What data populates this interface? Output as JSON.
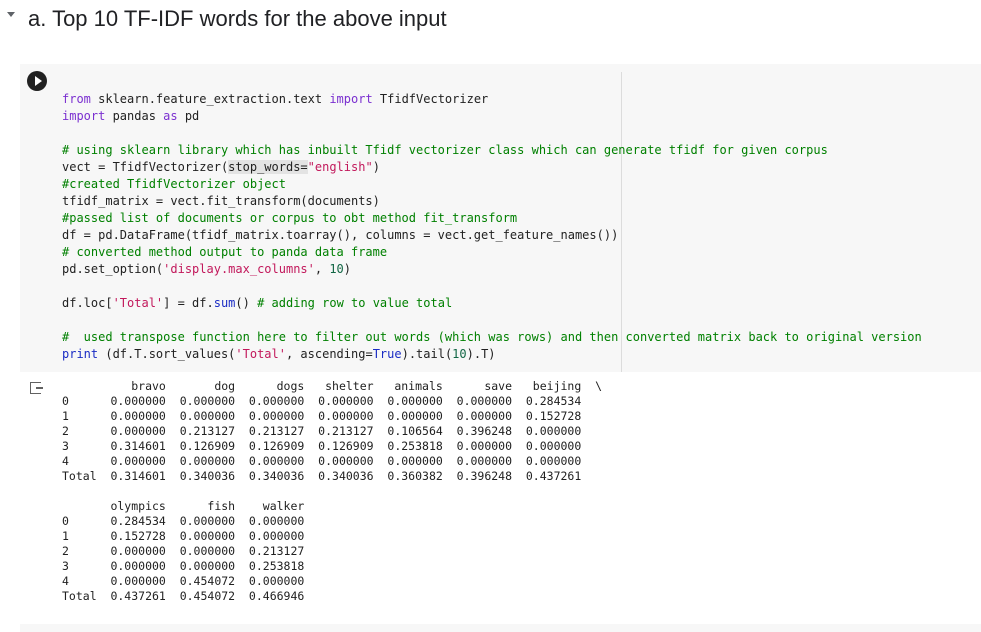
{
  "section": {
    "title": "a. Top 10 TF-IDF words for the above input"
  },
  "code_cell": {
    "run_button_icon": "play-icon",
    "lines": [
      [
        {
          "t": "from",
          "c": "kw"
        },
        {
          "t": " sklearn.feature_extraction.text "
        },
        {
          "t": "import",
          "c": "kw"
        },
        {
          "t": " TfidfVectorizer"
        }
      ],
      [
        {
          "t": "import",
          "c": "kw"
        },
        {
          "t": " pandas "
        },
        {
          "t": "as",
          "c": "kw"
        },
        {
          "t": " pd"
        }
      ],
      [],
      [
        {
          "t": "# using sklearn library which has inbuilt Tfidf vectorizer class which can generate tfidf for given corpus",
          "c": "cm"
        }
      ],
      [
        {
          "t": "vect = TfidfVectorizer("
        },
        {
          "t": "stop_words=",
          "c": "sel"
        },
        {
          "t": "\"english\"",
          "c": "st"
        },
        {
          "t": ")"
        }
      ],
      [
        {
          "t": "#created TfidfVectorizer object",
          "c": "cm"
        }
      ],
      [
        {
          "t": "tfidf_matrix = vect.fit_transform(documents)"
        }
      ],
      [
        {
          "t": "#passed list of documents or corpus to obt method fit_transform",
          "c": "cm"
        }
      ],
      [
        {
          "t": "df = pd.DataFrame(tfidf_matrix.toarray(), columns = vect.get_feature_names())"
        }
      ],
      [
        {
          "t": "# converted method output to panda data frame",
          "c": "cm"
        }
      ],
      [
        {
          "t": "pd.set_option("
        },
        {
          "t": "'display.max_columns'",
          "c": "st"
        },
        {
          "t": ", "
        },
        {
          "t": "10",
          "c": "nm"
        },
        {
          "t": ")"
        }
      ],
      [],
      [
        {
          "t": "df.loc["
        },
        {
          "t": "'Total'",
          "c": "st"
        },
        {
          "t": "] = df."
        },
        {
          "t": "sum",
          "c": "bl"
        },
        {
          "t": "() "
        },
        {
          "t": "# adding row to value total",
          "c": "cm"
        }
      ],
      [],
      [
        {
          "t": "#  used transpose function here to filter out words (which was rows) and then converted matrix back to original version",
          "c": "cm"
        }
      ],
      [
        {
          "t": "print",
          "c": "bl"
        },
        {
          "t": " (df.T.sort_values("
        },
        {
          "t": "'Total'",
          "c": "st"
        },
        {
          "t": ", ascending="
        },
        {
          "t": "True",
          "c": "bl"
        },
        {
          "t": ").tail("
        },
        {
          "t": "10",
          "c": "nm"
        },
        {
          "t": ").T)"
        }
      ]
    ]
  },
  "output": {
    "icon": "output-redirect-icon",
    "lines": [
      "          bravo       dog      dogs   shelter   animals      save   beijing  \\",
      "0      0.000000  0.000000  0.000000  0.000000  0.000000  0.000000  0.284534",
      "1      0.000000  0.000000  0.000000  0.000000  0.000000  0.000000  0.152728",
      "2      0.000000  0.213127  0.213127  0.213127  0.106564  0.396248  0.000000",
      "3      0.314601  0.126909  0.126909  0.126909  0.253818  0.000000  0.000000",
      "4      0.000000  0.000000  0.000000  0.000000  0.000000  0.000000  0.000000",
      "Total  0.314601  0.340036  0.340036  0.340036  0.360382  0.396248  0.437261",
      "",
      "       olympics      fish    walker  ",
      "0      0.284534  0.000000  0.000000  ",
      "1      0.152728  0.000000  0.000000  ",
      "2      0.000000  0.000000  0.213127  ",
      "3      0.000000  0.000000  0.253818  ",
      "4      0.000000  0.454072  0.000000  ",
      "Total  0.437261  0.454072  0.466946  "
    ]
  }
}
